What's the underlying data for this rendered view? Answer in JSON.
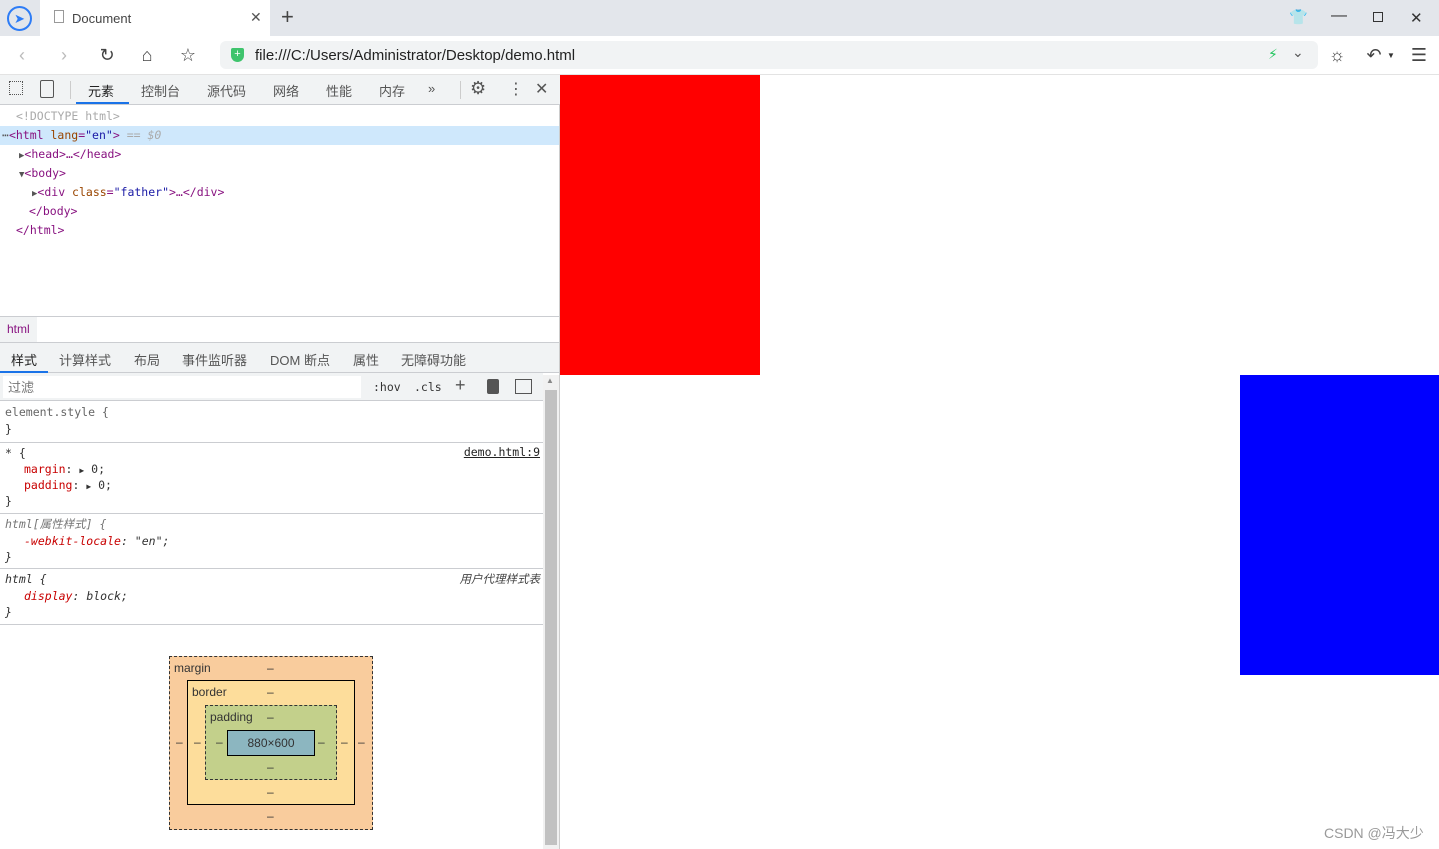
{
  "browser": {
    "tab_title": "Document",
    "url": "file:///C:/Users/Administrator/Desktop/demo.html"
  },
  "devtools": {
    "tabs": [
      "元素",
      "控制台",
      "源代码",
      "网络",
      "性能",
      "内存"
    ],
    "active_tab": "元素",
    "dom": {
      "doctype": "<!DOCTYPE html>",
      "html_open": "<html lang=\"en\">",
      "selected_marker": "== $0",
      "head": "<head>…</head>",
      "body_open": "<body>",
      "div": "<div class=\"father\">…</div>",
      "body_close": "</body>",
      "html_close": "</html>"
    },
    "breadcrumb": "html",
    "subtabs": [
      "样式",
      "计算样式",
      "布局",
      "事件监听器",
      "DOM 断点",
      "属性",
      "无障碍功能"
    ],
    "filter_placeholder": "过滤",
    "hov": ":hov",
    "cls": ".cls",
    "rules": {
      "element_style": "element.style {",
      "close": "}",
      "star_selector": "* {",
      "star_source": "demo.html:9",
      "margin_prop": "margin",
      "margin_val": "0;",
      "padding_prop": "padding",
      "padding_val": "0;",
      "attr_selector": "html[属性样式] {",
      "locale_prop": "-webkit-locale",
      "locale_val": "\"en\";",
      "ua_selector": "html {",
      "ua_source": "用户代理样式表",
      "display_prop": "display",
      "display_val": "block;"
    },
    "box_model": {
      "margin_label": "margin",
      "border_label": "border",
      "padding_label": "padding",
      "content": "880×600",
      "dash": "–",
      "colors": {
        "margin": "#f9cc9d",
        "border": "#fddd9b",
        "padding": "#c3d08b",
        "content": "#8cb6c0"
      }
    }
  },
  "page": {
    "red_box_color": "#ff0000",
    "blue_box_color": "#0000ff",
    "watermark": "CSDN @冯大少"
  }
}
